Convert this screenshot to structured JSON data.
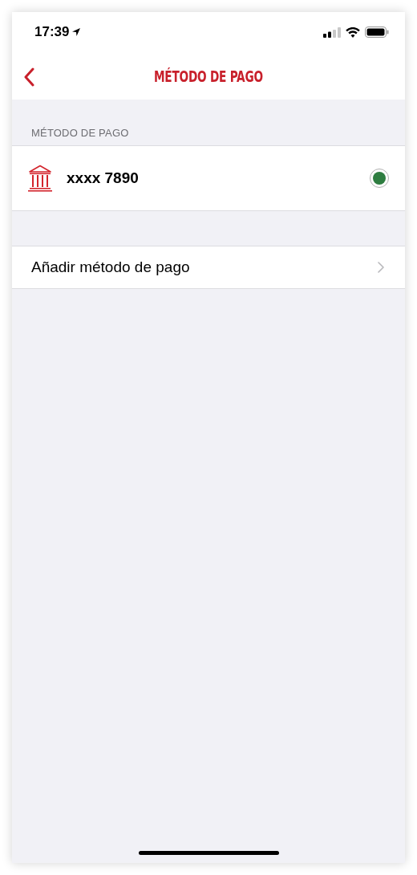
{
  "status_bar": {
    "time": "17:39"
  },
  "nav": {
    "title": "MÉTODO DE PAGO"
  },
  "section": {
    "header": "MÉTODO DE PAGO",
    "methods": [
      {
        "label": "xxxx 7890",
        "selected": true
      }
    ]
  },
  "add_row": {
    "label": "Añadir método de pago"
  }
}
